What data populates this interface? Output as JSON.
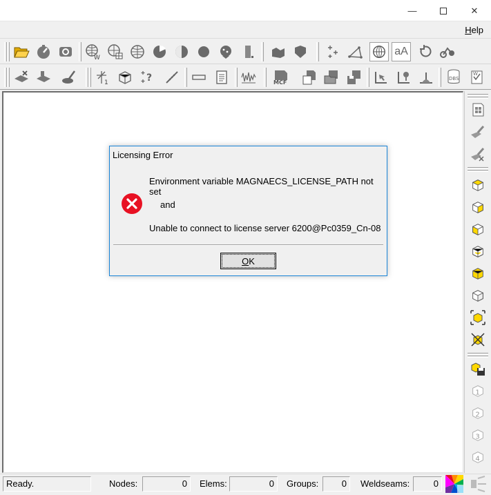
{
  "window": {
    "minimize_glyph": "—",
    "close_glyph": "✕"
  },
  "menu": {
    "help_label": "Help",
    "help_mnemonic": "H",
    "help_rest": "elp"
  },
  "colors": {
    "accent_border": "#1883d7",
    "error_red": "#e81123",
    "icon_yellow": "#ffd800"
  },
  "toolbar_row1": {
    "icons": [
      "open-folder-icon",
      "scale-icon",
      "capture-icon",
      "globe-w-icon",
      "globe-grid-icon",
      "globe-icon",
      "sphere-cut-icon",
      "sphere-shade-icon",
      "sphere-icon",
      "sphere-dots-icon",
      "column-icon",
      "solid-icon",
      "shield-solid-icon",
      "sparkle-icon",
      "triangle-points-icon",
      "wire-globe-icon",
      "text-size-icon",
      "rotate-icon",
      "bike-icon"
    ],
    "text_size_label": "aA"
  },
  "toolbar_row2": {
    "icons": [
      "delete-part-icon",
      "part-icon",
      "brush-icon",
      "axis-icon",
      "cube-icon",
      "sparkle-query-icon",
      "measure-icon",
      "rect-icon",
      "document-icon",
      "waveform-icon",
      "mcf-icon",
      "doc-w-icon",
      "folder-icon",
      "save-icon",
      "cursor-tree-icon",
      "pin-icon",
      "angle-icon",
      "dbs-icon",
      "doc-check-icon"
    ],
    "mcf_label": "MCF",
    "dbs_label": "DBS"
  },
  "right_toolbar": {
    "icons": [
      "sheet-grid-icon",
      "brush-dim-icon",
      "brush-x-icon",
      "cube-1-icon",
      "cube-2-icon",
      "cube-3-icon",
      "cube-4-icon",
      "cube-5-icon",
      "cube-6-icon",
      "cube-select-icon",
      "cube-x-icon",
      "cube-save-icon",
      "cube-num-1-icon",
      "cube-num-2-icon",
      "cube-num-3-icon",
      "cube-num-4-icon",
      "light-icon"
    ],
    "numbers": [
      "1",
      "2",
      "3",
      "4"
    ]
  },
  "dialog": {
    "title": "Licensing Error",
    "line1": "Environment variable MAGNAECS_LICENSE_PATH not set",
    "line2": "and",
    "line3": "Unable to connect to license server 6200@Pc0359_Cn-08",
    "ok_mnemonic": "O",
    "ok_rest": "K"
  },
  "status": {
    "ready": "Ready.",
    "nodes_label": "Nodes:",
    "nodes_value": "0",
    "elems_label": "Elems:",
    "elems_value": "0",
    "groups_label": "Groups:",
    "groups_value": "0",
    "weldseams_label": "Weldseams:",
    "weldseams_value": "0"
  }
}
